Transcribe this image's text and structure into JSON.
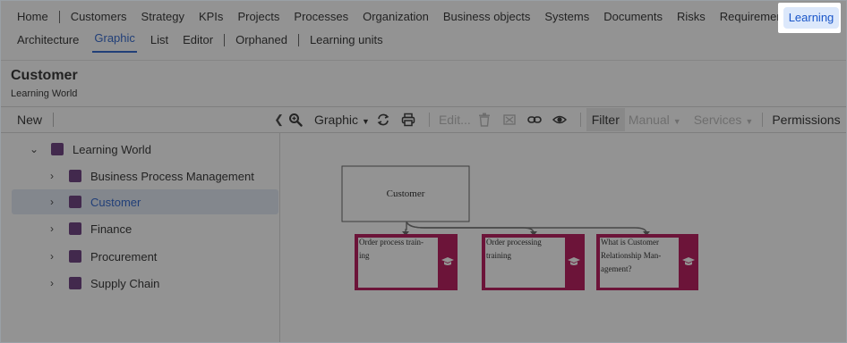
{
  "topnav": {
    "primary": [
      "Home",
      "Customers",
      "Strategy",
      "KPIs",
      "Projects",
      "Processes",
      "Organization",
      "Business objects",
      "Systems",
      "Documents",
      "Risks",
      "Requirements"
    ],
    "learning": "Learning",
    "secondary": {
      "architecture": "Architecture",
      "graphic": "Graphic",
      "list": "List",
      "editor": "Editor",
      "orphaned": "Orphaned",
      "learning_units": "Learning units"
    }
  },
  "header": {
    "title": "Customer",
    "subtitle": "Learning World"
  },
  "toolbar": {
    "new": "New",
    "graphic": "Graphic",
    "edit": "Edit...",
    "filter": "Filter",
    "manual": "Manual",
    "services": "Services",
    "permissions": "Permissions"
  },
  "tree": {
    "root": "Learning World",
    "items": [
      {
        "label": "Business Process Management",
        "selected": false
      },
      {
        "label": "Customer",
        "selected": true
      },
      {
        "label": "Finance",
        "selected": false
      },
      {
        "label": "Procurement",
        "selected": false
      },
      {
        "label": "Supply Chain",
        "selected": false
      }
    ]
  },
  "diagram": {
    "root_label": "Customer",
    "children": [
      {
        "lines": [
          "Order process train-",
          "ing"
        ]
      },
      {
        "lines": [
          "Order processing",
          "training"
        ]
      },
      {
        "lines": [
          "What is Customer",
          "Relationship Man-",
          "agement?"
        ]
      }
    ],
    "accent": "#b0004a"
  },
  "colors": {
    "accent_blue": "#1a56c9",
    "folder": "#5c2a72",
    "learning_unit": "#b0004a"
  }
}
